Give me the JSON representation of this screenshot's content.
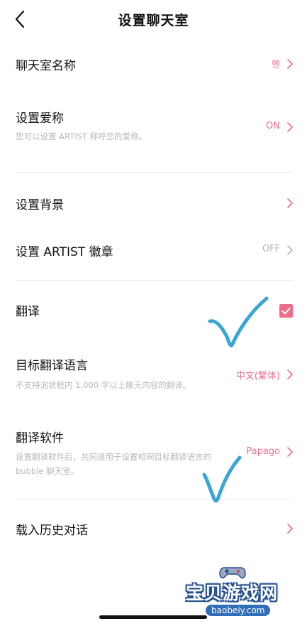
{
  "header": {
    "title": "设置聊天室"
  },
  "rows": {
    "chatroom_name": {
      "label": "聊天室名称",
      "value": "헨"
    },
    "nickname": {
      "label": "设置爱称",
      "desc": "您可以设置 ARTIST 称呼您的爱称。",
      "value": "ON"
    },
    "background": {
      "label": "设置背景"
    },
    "artist_badge": {
      "label": "设置 ARTIST 徽章",
      "value": "OFF"
    },
    "translate": {
      "label": "翻译",
      "checked": true
    },
    "target_language": {
      "label": "目标翻译语言",
      "desc": "不支持泡状框内 1,000 字以上聊天内容的翻译。",
      "value": "中文(繁体)"
    },
    "translate_software": {
      "label": "翻译软件",
      "desc_line1": "设置翻译软件后，共同适用于设置相同目标翻译语言的",
      "desc_line2": "bubble 聊天室。",
      "value": "Papago"
    },
    "history": {
      "label": "载入历史对话"
    }
  },
  "watermark": {
    "text": "宝贝游戏网",
    "url": "baobeiy.com"
  },
  "colors": {
    "accent": "#ef6d8b",
    "value_off": "#b5b5b5",
    "desc": "#b7b7b7",
    "divider": "#ececec",
    "pen_mark": "#3aa6d6"
  }
}
